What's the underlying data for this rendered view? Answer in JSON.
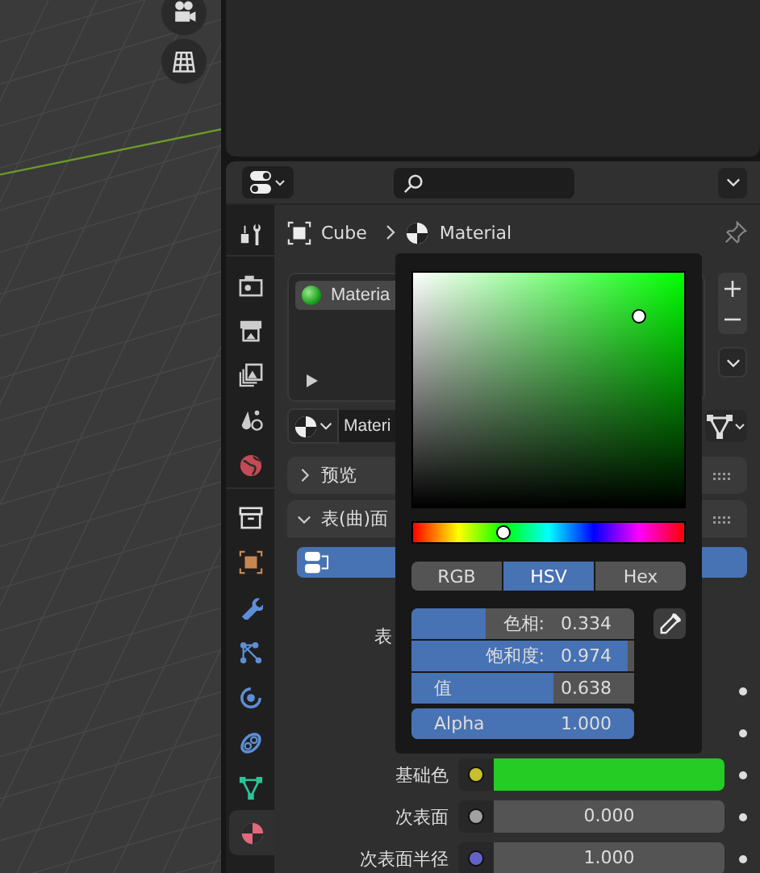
{
  "properties": {
    "tabs": [
      {
        "kind": "tool",
        "selected": false
      },
      {
        "kind": "render",
        "selected": false
      },
      {
        "kind": "output",
        "selected": false
      },
      {
        "kind": "view_layer",
        "selected": false
      },
      {
        "kind": "scene",
        "selected": false
      },
      {
        "kind": "world",
        "selected": false
      },
      {
        "kind": "collection",
        "selected": false
      },
      {
        "kind": "object",
        "selected": false
      },
      {
        "kind": "modifier",
        "selected": false
      },
      {
        "kind": "particles",
        "selected": false
      },
      {
        "kind": "physics",
        "selected": false
      },
      {
        "kind": "constraints",
        "selected": false
      },
      {
        "kind": "data",
        "selected": false
      },
      {
        "kind": "material",
        "selected": true
      }
    ],
    "breadcrumb": [
      {
        "kind": "object",
        "label": "Cube"
      },
      {
        "kind": "material",
        "label": "Material"
      }
    ],
    "slots": [
      {
        "label": "Materia",
        "selected": true
      }
    ],
    "material_field": {
      "value": "Materi"
    },
    "panels": [
      {
        "title": "预览",
        "expanded": false
      },
      {
        "title": "表(曲)面",
        "expanded": true
      }
    ],
    "surface_rows": [
      {
        "kind": "label_only",
        "label": "表"
      },
      {
        "kind": "covered"
      },
      {
        "kind": "covered"
      },
      {
        "kind": "color",
        "label": "基础色",
        "color": "#c7c02a",
        "swatch": {
          "color": "#24cc24"
        }
      },
      {
        "kind": "number",
        "label": "次表面",
        "color": "#a1a1a1",
        "value": "0.000"
      },
      {
        "kind": "number",
        "label": "次表面半径",
        "color": "#6363c7",
        "value": "1.000"
      }
    ]
  },
  "color_picker": {
    "sv_cursor": {
      "saturation": {
        "level": 0.835
      },
      "value": {
        "level": 0.813
      }
    },
    "hue": {
      "level": 0.334
    },
    "modes": [
      {
        "label": "RGB",
        "selected": false
      },
      {
        "label": "HSV",
        "selected": true
      },
      {
        "label": "Hex",
        "selected": false
      }
    ],
    "fields": [
      {
        "kind": "inline",
        "label": "色相:",
        "value": "0.334",
        "level": 0.334
      },
      {
        "kind": "inline",
        "label": "饱和度:",
        "value": "0.974",
        "level": 0.974
      },
      {
        "kind": "split",
        "label": "值",
        "value": "0.638",
        "level": 0.638
      },
      {
        "kind": "split",
        "label": "Alpha",
        "value": "1.000",
        "level": 1
      }
    ]
  }
}
